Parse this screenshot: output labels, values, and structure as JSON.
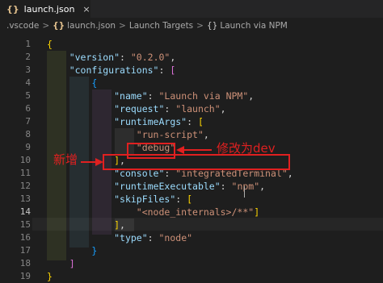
{
  "tab": {
    "icon": "json-icon",
    "glyph": "{}",
    "title": "launch.json",
    "close_glyph": "×"
  },
  "breadcrumb": {
    "items": [
      ".vscode",
      "launch.json",
      "Launch Targets",
      "Launch via NPM"
    ],
    "separator": ">",
    "json_icon_glyph": "{}",
    "object_icon_glyph": "{}"
  },
  "editor": {
    "active_line": 14,
    "lines": [
      {
        "n": "1",
        "tokens": [
          [
            "b1",
            "{"
          ]
        ]
      },
      {
        "n": "2",
        "tokens": [
          [
            "ind",
            "    "
          ],
          [
            "key",
            "\"version\""
          ],
          [
            "punc",
            ": "
          ],
          [
            "str",
            "\"0.2.0\""
          ],
          [
            "punc",
            ","
          ]
        ]
      },
      {
        "n": "3",
        "tokens": [
          [
            "ind",
            "    "
          ],
          [
            "key",
            "\"configurations\""
          ],
          [
            "punc",
            ": "
          ],
          [
            "b2",
            "["
          ]
        ]
      },
      {
        "n": "4",
        "tokens": [
          [
            "ind",
            "        "
          ],
          [
            "b3",
            "{"
          ]
        ]
      },
      {
        "n": "5",
        "tokens": [
          [
            "ind",
            "            "
          ],
          [
            "key",
            "\"name\""
          ],
          [
            "punc",
            ": "
          ],
          [
            "str",
            "\"Launch via NPM\""
          ],
          [
            "punc",
            ","
          ]
        ]
      },
      {
        "n": "6",
        "tokens": [
          [
            "ind",
            "            "
          ],
          [
            "key",
            "\"request\""
          ],
          [
            "punc",
            ": "
          ],
          [
            "str",
            "\"launch\""
          ],
          [
            "punc",
            ","
          ]
        ]
      },
      {
        "n": "7",
        "tokens": [
          [
            "ind",
            "            "
          ],
          [
            "key",
            "\"runtimeArgs\""
          ],
          [
            "punc",
            ": "
          ],
          [
            "b1",
            "["
          ]
        ]
      },
      {
        "n": "8",
        "tokens": [
          [
            "ind",
            "                "
          ],
          [
            "str",
            "\"run-script\""
          ],
          [
            "punc",
            ","
          ]
        ]
      },
      {
        "n": "9",
        "tokens": [
          [
            "ind",
            "                "
          ],
          [
            "str",
            "\"debug\""
          ]
        ]
      },
      {
        "n": "10",
        "tokens": [
          [
            "ind",
            "            "
          ],
          [
            "b1",
            "]"
          ],
          [
            "punc",
            ","
          ]
        ]
      },
      {
        "n": "11",
        "tokens": [
          [
            "ind",
            "            "
          ],
          [
            "key",
            "\"console\""
          ],
          [
            "punc",
            ": "
          ],
          [
            "str",
            "\"integratedTerminal\""
          ],
          [
            "punc",
            ","
          ]
        ]
      },
      {
        "n": "12",
        "tokens": [
          [
            "ind",
            "            "
          ],
          [
            "key",
            "\"runtimeExecutable\""
          ],
          [
            "punc",
            ": "
          ],
          [
            "str",
            "\"npm\""
          ],
          [
            "punc",
            ","
          ]
        ]
      },
      {
        "n": "13",
        "tokens": [
          [
            "ind",
            "            "
          ],
          [
            "key",
            "\"skipFiles\""
          ],
          [
            "punc",
            ": "
          ],
          [
            "b1",
            "["
          ]
        ]
      },
      {
        "n": "14",
        "tokens": [
          [
            "ind",
            "                "
          ],
          [
            "str",
            "\"<node_internals>/**\""
          ],
          [
            "b1",
            "]"
          ]
        ]
      },
      {
        "n": "15",
        "tokens": [
          [
            "ind",
            "            "
          ],
          [
            "b1",
            "]"
          ],
          [
            "punc",
            ","
          ]
        ]
      },
      {
        "n": "16",
        "tokens": [
          [
            "ind",
            "            "
          ],
          [
            "key",
            "\"type\""
          ],
          [
            "punc",
            ": "
          ],
          [
            "str",
            "\"node\""
          ]
        ]
      },
      {
        "n": "17",
        "tokens": [
          [
            "ind",
            "        "
          ],
          [
            "b3",
            "}"
          ]
        ]
      },
      {
        "n": "18",
        "tokens": [
          [
            "ind",
            "    "
          ],
          [
            "b2",
            "]"
          ]
        ]
      },
      {
        "n": "19",
        "tokens": [
          [
            "b1",
            "}"
          ]
        ]
      }
    ]
  },
  "annotations": {
    "modify": "修改为dev",
    "added": "新增",
    "highlight_color": "#e02020"
  }
}
